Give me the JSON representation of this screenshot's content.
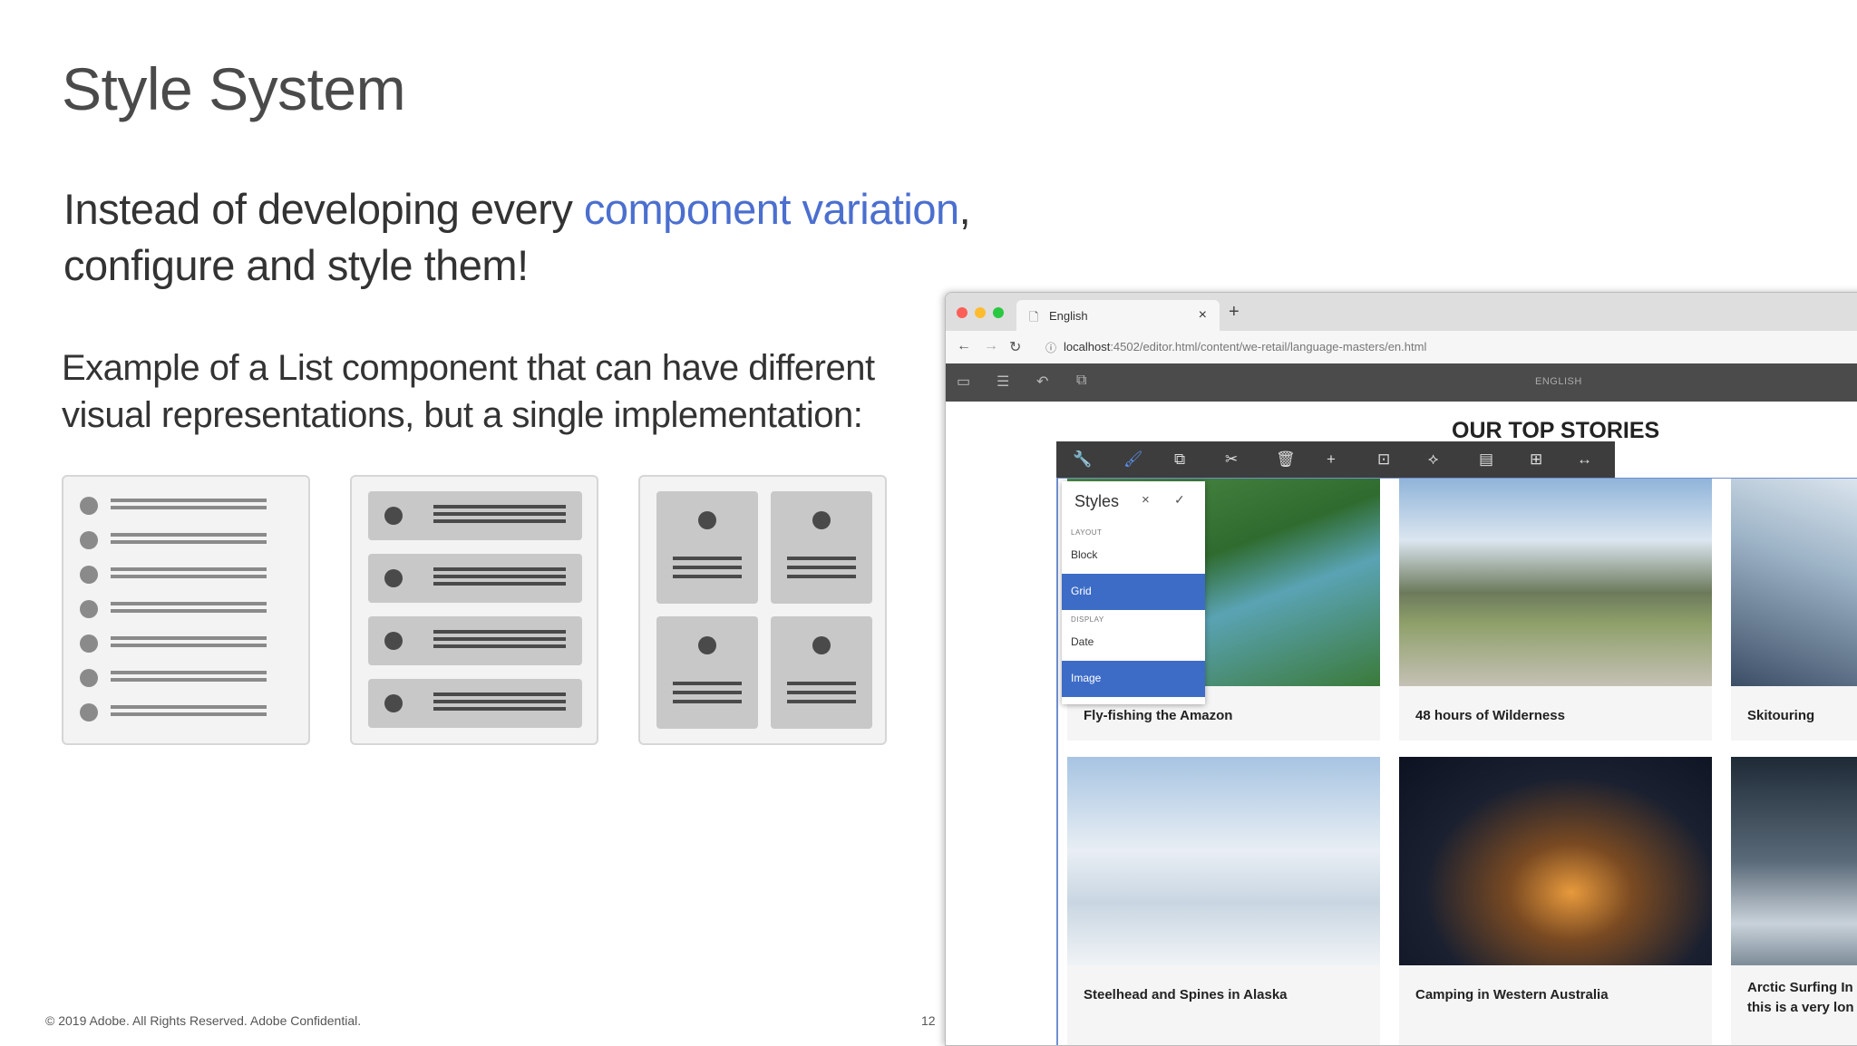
{
  "slide": {
    "title": "Style System",
    "intro_line1_pre": "Instead of developing every ",
    "intro_highlight": "component variation",
    "intro_line1_post": ",",
    "intro_line2": "configure and style them!",
    "example_line1": "Example of a List component that can have different",
    "example_line2": "visual representations, but a single implementation:",
    "footer": "© 2019 Adobe.  All Rights Reserved.  Adobe Confidential.",
    "page_number": "12"
  },
  "browser": {
    "tab_label": "English",
    "tab_icon": "page-icon",
    "url_host": "localhost",
    "url_path": ":4502/editor.html/content/we-retail/language-masters/en.html",
    "editor_label": "ENGLISH"
  },
  "page": {
    "heading": "OUR TOP STORIES",
    "stories": [
      {
        "caption": "Fly-fishing the Amazon"
      },
      {
        "caption": "48 hours of Wilderness"
      },
      {
        "caption": "Skitouring"
      },
      {
        "caption": "Steelhead and Spines in Alaska"
      },
      {
        "caption": "Camping in Western Australia"
      },
      {
        "caption_line1": "Arctic Surfing In",
        "caption_line2": "this is a very lon"
      }
    ]
  },
  "styles_panel": {
    "title": "Styles",
    "group_layout": "LAYOUT",
    "item_block": "Block",
    "item_grid": "Grid",
    "group_display": "DISPLAY",
    "item_date": "Date",
    "item_image": "Image",
    "selected": [
      "Grid",
      "Image"
    ]
  },
  "colors": {
    "accent": "#4b6fcf",
    "selected_style": "#3d6cc7",
    "editor_bar": "#4b4b4b"
  }
}
